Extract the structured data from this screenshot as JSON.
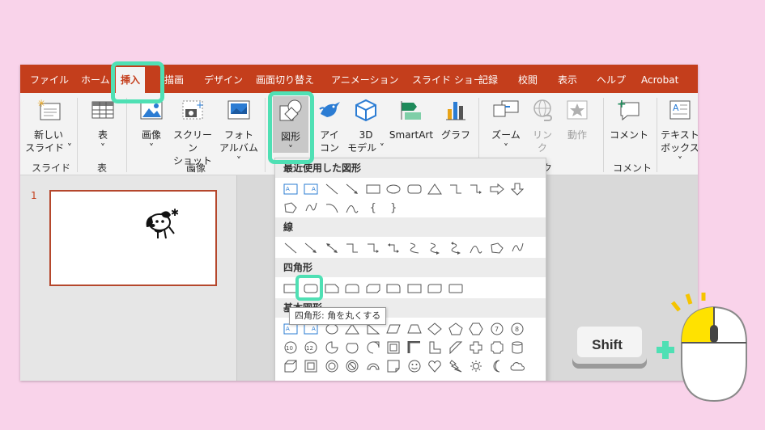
{
  "tabs": [
    "ファイル",
    "ホーム",
    "挿入",
    "描画",
    "デザイン",
    "画面切り替え",
    "アニメーション",
    "スライド ショー",
    "記録",
    "校閲",
    "表示",
    "ヘルプ",
    "Acrobat"
  ],
  "ribbon": {
    "new_slide": [
      "新しい",
      "スライド ˅"
    ],
    "table": [
      "表",
      "˅"
    ],
    "images": [
      "画像",
      "˅"
    ],
    "screenshot": [
      "スクリーン",
      "ショット ˅"
    ],
    "photo_album": [
      "フォト",
      "アルバム ˅"
    ],
    "shapes": [
      "図形",
      "˅"
    ],
    "icons": [
      "アイ",
      "コン"
    ],
    "model3d": [
      "3D",
      "モデル ˅"
    ],
    "smartart": "SmartArt",
    "chart": "グラフ",
    "zoom": [
      "ズーム",
      "˅"
    ],
    "link": [
      "リン",
      "ク"
    ],
    "action": "動作",
    "comment": "コメント",
    "textbox": [
      "テキスト",
      "ボックス ˅"
    ],
    "groups": {
      "slide": "スライド",
      "table": "表",
      "images": "画像",
      "links_partial": "ク",
      "comment": "コメント"
    }
  },
  "slide_number": "1",
  "shapes_gallery": {
    "recent": "最近使用した図形",
    "lines": "線",
    "rectangles": "四角形",
    "basic": "基本図形"
  },
  "tooltip": "四角形: 角を丸くする",
  "shift_key": "Shift",
  "colors": {
    "ribbon": "#c43e1c",
    "highlight": "#4fe0b4",
    "background": "#f9d3ea"
  }
}
